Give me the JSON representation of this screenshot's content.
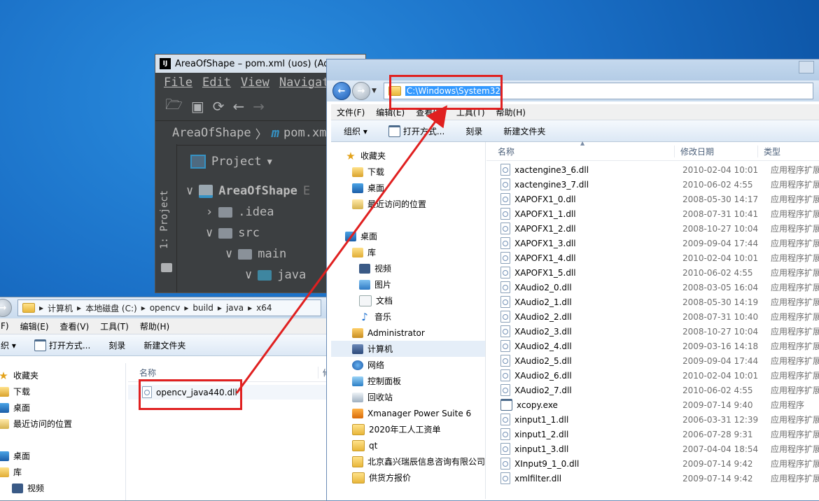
{
  "intellij": {
    "logo": "IJ",
    "title": "AreaOfShape – pom.xml (uos) (Admin",
    "menu": [
      "File",
      "Edit",
      "View",
      "Navigat"
    ],
    "breadcrumb": {
      "project": "AreaOfShape",
      "file": "pom.xm"
    },
    "side_tab": "1: Project",
    "panel_title": "Project",
    "tree": [
      {
        "label": "AreaOfShape",
        "suffix": "E",
        "level": 0,
        "expanded": true,
        "module": true
      },
      {
        "label": ".idea",
        "level": 1,
        "expanded": false
      },
      {
        "label": "src",
        "level": 1,
        "expanded": true
      },
      {
        "label": "main",
        "level": 2,
        "expanded": true
      },
      {
        "label": "java",
        "level": 3,
        "expanded": true
      }
    ]
  },
  "explorer_left": {
    "address": [
      "计算机",
      "本地磁盘 (C:)",
      "opencv",
      "build",
      "java",
      "x64"
    ],
    "menu": [
      "F)",
      "编辑(E)",
      "查看(V)",
      "工具(T)",
      "帮助(H)"
    ],
    "commands": [
      "织 ▾",
      "打开方式...",
      "刻录",
      "新建文件夹"
    ],
    "nav": [
      {
        "label": "收藏夹",
        "icon": "star"
      },
      {
        "label": "下载",
        "icon": "dl"
      },
      {
        "label": "桌面",
        "icon": "desk"
      },
      {
        "label": "最近访问的位置",
        "icon": "recent"
      },
      {
        "label": "",
        "icon": "none"
      },
      {
        "label": "桌面",
        "icon": "desk"
      },
      {
        "label": "库",
        "icon": "lib"
      },
      {
        "label": "视频",
        "icon": "video"
      }
    ],
    "column_name": "名称",
    "column_partial": "修",
    "file": {
      "name": "opencv_java440.dll",
      "partial": "2"
    }
  },
  "explorer_right": {
    "address": "C:\\Windows\\System32",
    "menu": [
      "文件(F)",
      "编辑(E)",
      "查看(V)",
      "工具(T)",
      "帮助(H)"
    ],
    "commands": [
      "组织 ▾",
      "打开方式...",
      "刻录",
      "新建文件夹"
    ],
    "nav": [
      {
        "label": "收藏夹",
        "icon": "star"
      },
      {
        "label": "下载",
        "icon": "dl"
      },
      {
        "label": "桌面",
        "icon": "desk"
      },
      {
        "label": "最近访问的位置",
        "icon": "recent"
      },
      {
        "label": "",
        "icon": "none"
      },
      {
        "label": "桌面",
        "icon": "desk"
      },
      {
        "label": "库",
        "icon": "lib"
      },
      {
        "label": "视频",
        "icon": "video"
      },
      {
        "label": "图片",
        "icon": "pic"
      },
      {
        "label": "文档",
        "icon": "doc"
      },
      {
        "label": "音乐",
        "icon": "music"
      },
      {
        "label": "Administrator",
        "icon": "user"
      },
      {
        "label": "计算机",
        "icon": "pc",
        "selected": true
      },
      {
        "label": "网络",
        "icon": "net"
      },
      {
        "label": "控制面板",
        "icon": "cp"
      },
      {
        "label": "回收站",
        "icon": "bin"
      },
      {
        "label": "Xmanager Power Suite 6",
        "icon": "xm"
      },
      {
        "label": "2020年工人工资单",
        "icon": "fold"
      },
      {
        "label": "qt",
        "icon": "fold"
      },
      {
        "label": "北京鑫兴瑞辰信息咨询有限公司",
        "icon": "fold"
      },
      {
        "label": "供货方报价",
        "icon": "fold"
      }
    ],
    "columns": {
      "name": "名称",
      "date": "修改日期",
      "type": "类型"
    },
    "files": [
      {
        "name": "xactengine3_6.dll",
        "date": "2010-02-04 10:01",
        "type": "应用程序扩展",
        "icon": "dll"
      },
      {
        "name": "xactengine3_7.dll",
        "date": "2010-06-02 4:55",
        "type": "应用程序扩展",
        "icon": "dll"
      },
      {
        "name": "XAPOFX1_0.dll",
        "date": "2008-05-30 14:17",
        "type": "应用程序扩展",
        "icon": "dll"
      },
      {
        "name": "XAPOFX1_1.dll",
        "date": "2008-07-31 10:41",
        "type": "应用程序扩展",
        "icon": "dll"
      },
      {
        "name": "XAPOFX1_2.dll",
        "date": "2008-10-27 10:04",
        "type": "应用程序扩展",
        "icon": "dll"
      },
      {
        "name": "XAPOFX1_3.dll",
        "date": "2009-09-04 17:44",
        "type": "应用程序扩展",
        "icon": "dll"
      },
      {
        "name": "XAPOFX1_4.dll",
        "date": "2010-02-04 10:01",
        "type": "应用程序扩展",
        "icon": "dll"
      },
      {
        "name": "XAPOFX1_5.dll",
        "date": "2010-06-02 4:55",
        "type": "应用程序扩展",
        "icon": "dll"
      },
      {
        "name": "XAudio2_0.dll",
        "date": "2008-03-05 16:04",
        "type": "应用程序扩展",
        "icon": "dll"
      },
      {
        "name": "XAudio2_1.dll",
        "date": "2008-05-30 14:19",
        "type": "应用程序扩展",
        "icon": "dll"
      },
      {
        "name": "XAudio2_2.dll",
        "date": "2008-07-31 10:40",
        "type": "应用程序扩展",
        "icon": "dll"
      },
      {
        "name": "XAudio2_3.dll",
        "date": "2008-10-27 10:04",
        "type": "应用程序扩展",
        "icon": "dll"
      },
      {
        "name": "XAudio2_4.dll",
        "date": "2009-03-16 14:18",
        "type": "应用程序扩展",
        "icon": "dll"
      },
      {
        "name": "XAudio2_5.dll",
        "date": "2009-09-04 17:44",
        "type": "应用程序扩展",
        "icon": "dll"
      },
      {
        "name": "XAudio2_6.dll",
        "date": "2010-02-04 10:01",
        "type": "应用程序扩展",
        "icon": "dll"
      },
      {
        "name": "XAudio2_7.dll",
        "date": "2010-06-02 4:55",
        "type": "应用程序扩展",
        "icon": "dll"
      },
      {
        "name": "xcopy.exe",
        "date": "2009-07-14 9:40",
        "type": "应用程序",
        "icon": "exe"
      },
      {
        "name": "xinput1_1.dll",
        "date": "2006-03-31 12:39",
        "type": "应用程序扩展",
        "icon": "dll"
      },
      {
        "name": "xinput1_2.dll",
        "date": "2006-07-28 9:31",
        "type": "应用程序扩展",
        "icon": "dll"
      },
      {
        "name": "xinput1_3.dll",
        "date": "2007-04-04 18:54",
        "type": "应用程序扩展",
        "icon": "dll"
      },
      {
        "name": "XInput9_1_0.dll",
        "date": "2009-07-14 9:42",
        "type": "应用程序扩展",
        "icon": "dll"
      },
      {
        "name": "xmlfilter.dll",
        "date": "2009-07-14 9:42",
        "type": "应用程序扩展",
        "icon": "dll"
      }
    ]
  },
  "colors": {
    "annotation": "#e02020",
    "address_selection": "#3399ff"
  }
}
